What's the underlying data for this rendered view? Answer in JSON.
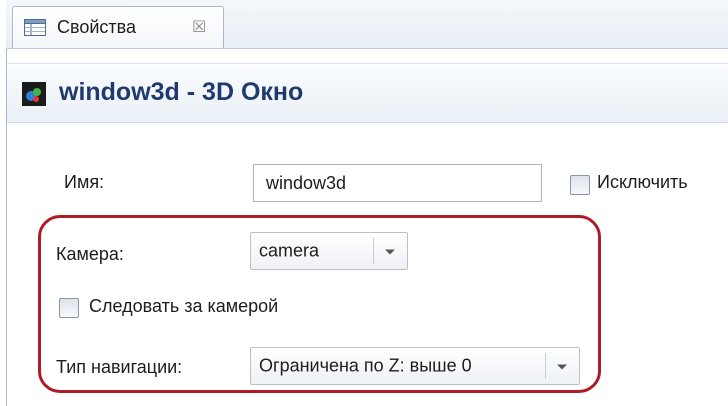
{
  "tab": {
    "label": "Свойства",
    "close_glyph": "☒",
    "icon": "properties-table-icon"
  },
  "header": {
    "icon": "window3d-icon",
    "title": "window3d - 3D Окно"
  },
  "form": {
    "name_label": "Имя:",
    "name_value": "window3d",
    "exclude_label": "Исключить",
    "exclude_checked": false,
    "camera_label": "Камера:",
    "camera_value": "camera",
    "follow_camera_label": "Следовать за камерой",
    "follow_camera_checked": false,
    "navigation_label": "Тип навигации:",
    "navigation_value": "Ограничена по Z: выше 0"
  },
  "colors": {
    "highlight": "#b01c26",
    "header_title": "#1f3b6e"
  }
}
